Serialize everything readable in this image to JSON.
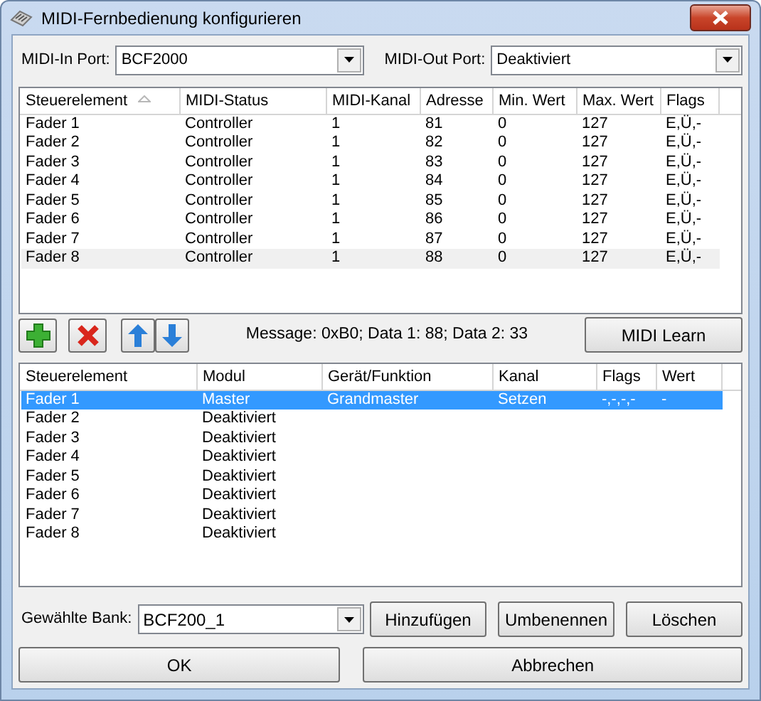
{
  "window": {
    "title": "MIDI-Fernbedienung konfigurieren"
  },
  "midi_in": {
    "label": "MIDI-In Port:",
    "value": "BCF2000"
  },
  "midi_out": {
    "label": "MIDI-Out Port:",
    "value": "Deaktiviert"
  },
  "controls_table": {
    "columns": [
      {
        "label": "Steuerelement",
        "sorted": true
      },
      {
        "label": "MIDI-Status",
        "sorted": false
      },
      {
        "label": "MIDI-Kanal",
        "sorted": false
      },
      {
        "label": "Adresse",
        "sorted": false
      },
      {
        "label": "Min. Wert",
        "sorted": false
      },
      {
        "label": "Max. Wert",
        "sorted": false
      },
      {
        "label": "Flags",
        "sorted": false
      }
    ],
    "rows": [
      {
        "cells": [
          "Fader 1",
          "Controller",
          "1",
          "81",
          "0",
          "127",
          "E,Ü,-"
        ],
        "selected": false
      },
      {
        "cells": [
          "Fader 2",
          "Controller",
          "1",
          "82",
          "0",
          "127",
          "E,Ü,-"
        ],
        "selected": false
      },
      {
        "cells": [
          "Fader 3",
          "Controller",
          "1",
          "83",
          "0",
          "127",
          "E,Ü,-"
        ],
        "selected": false
      },
      {
        "cells": [
          "Fader 4",
          "Controller",
          "1",
          "84",
          "0",
          "127",
          "E,Ü,-"
        ],
        "selected": false
      },
      {
        "cells": [
          "Fader 5",
          "Controller",
          "1",
          "85",
          "0",
          "127",
          "E,Ü,-"
        ],
        "selected": false
      },
      {
        "cells": [
          "Fader 6",
          "Controller",
          "1",
          "86",
          "0",
          "127",
          "E,Ü,-"
        ],
        "selected": false
      },
      {
        "cells": [
          "Fader 7",
          "Controller",
          "1",
          "87",
          "0",
          "127",
          "E,Ü,-"
        ],
        "selected": false
      },
      {
        "cells": [
          "Fader 8",
          "Controller",
          "1",
          "88",
          "0",
          "127",
          "E,Ü,-"
        ],
        "selected": true
      }
    ]
  },
  "toolbar": {
    "message": "Message: 0xB0; Data 1: 88; Data 2: 33",
    "learn_button": "MIDI Learn"
  },
  "mapping_table": {
    "columns": [
      {
        "label": "Steuerelement",
        "sorted": false
      },
      {
        "label": "Modul",
        "sorted": false
      },
      {
        "label": "Gerät/Funktion",
        "sorted": false
      },
      {
        "label": "Kanal",
        "sorted": false
      },
      {
        "label": "Flags",
        "sorted": false
      },
      {
        "label": "Wert",
        "sorted": false
      }
    ],
    "rows": [
      {
        "cells": [
          "Fader 1",
          "Master",
          "Grandmaster",
          "Setzen",
          "-,-,-,-",
          "-"
        ],
        "selected": true
      },
      {
        "cells": [
          "Fader 2",
          "Deaktiviert"
        ],
        "selected": false
      },
      {
        "cells": [
          "Fader 3",
          "Deaktiviert"
        ],
        "selected": false
      },
      {
        "cells": [
          "Fader 4",
          "Deaktiviert"
        ],
        "selected": false
      },
      {
        "cells": [
          "Fader 5",
          "Deaktiviert"
        ],
        "selected": false
      },
      {
        "cells": [
          "Fader 6",
          "Deaktiviert"
        ],
        "selected": false
      },
      {
        "cells": [
          "Fader 7",
          "Deaktiviert"
        ],
        "selected": false
      },
      {
        "cells": [
          "Fader 8",
          "Deaktiviert"
        ],
        "selected": false
      }
    ]
  },
  "bank": {
    "label": "Gewählte Bank:",
    "value": "BCF200_1"
  },
  "bank_buttons": [
    "Hinzufügen",
    "Umbenennen",
    "Löschen"
  ],
  "buttons": [
    "OK",
    "Abbrechen"
  ]
}
